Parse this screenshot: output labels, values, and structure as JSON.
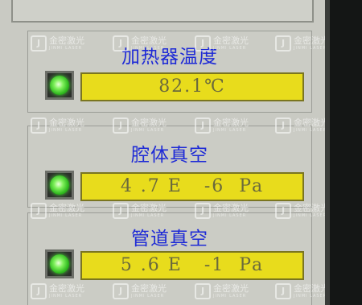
{
  "panels": [
    {
      "title": "加热器温度",
      "value": "82.1℃",
      "status": "normal"
    },
    {
      "title": "腔体真空",
      "value": "4 .7 E   -6  Pa",
      "status": "normal"
    },
    {
      "title": "管道真空",
      "value": "5 .6 E   -1  Pa",
      "status": "normal"
    }
  ],
  "watermark": {
    "brand_cn": "金密激光",
    "brand_en": "JINMI LASER"
  },
  "colors": {
    "title_text": "#1e2ad6",
    "value_background": "#e8dc1c",
    "indicator_on": "#2fb81e",
    "screen_background": "#c9cac3"
  },
  "icons": {
    "indicator": "green-status-led-icon",
    "watermark": "jinmi-logo-icon"
  }
}
